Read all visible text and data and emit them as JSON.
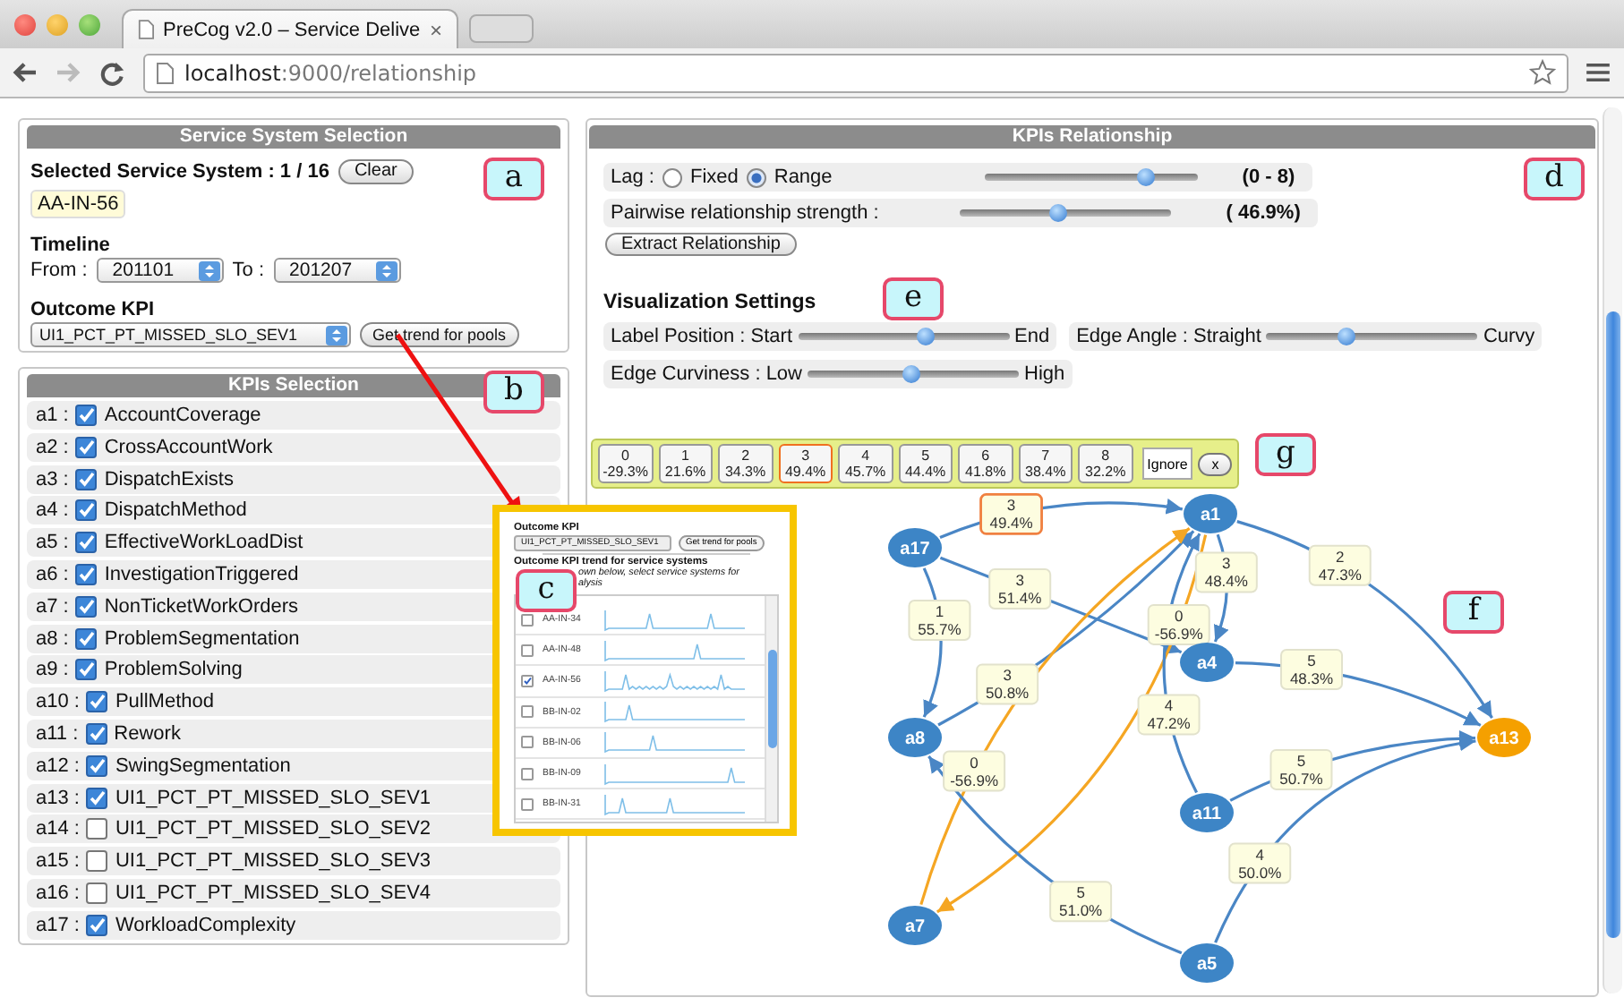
{
  "browser": {
    "tab_title": "PreCog v2.0 – Service Delive",
    "tab_close": "×",
    "url_host": "localhost",
    "url_path": ":9000/relationship"
  },
  "service_selection": {
    "title": "Service System Selection",
    "selected_label": "Selected Service System : 1 / 16",
    "clear_button": "Clear",
    "selected_tags": [
      "AA-IN-56"
    ],
    "timeline_label": "Timeline",
    "from_label": "From :",
    "from_value": "201101",
    "to_label": "To :",
    "to_value": "201207",
    "outcome_label": "Outcome KPI",
    "outcome_value": "UI1_PCT_PT_MISSED_SLO_SEV1",
    "trend_button": "Get trend for pools"
  },
  "kpi_selection": {
    "title": "KPIs Selection",
    "items": [
      {
        "id": "a1 :",
        "name": "AccountCoverage",
        "checked": true
      },
      {
        "id": "a2 :",
        "name": "CrossAccountWork",
        "checked": true
      },
      {
        "id": "a3 :",
        "name": "DispatchExists",
        "checked": true
      },
      {
        "id": "a4 :",
        "name": "DispatchMethod",
        "checked": true
      },
      {
        "id": "a5 :",
        "name": "EffectiveWorkLoadDist",
        "checked": true
      },
      {
        "id": "a6 :",
        "name": "InvestigationTriggered",
        "checked": true
      },
      {
        "id": "a7 :",
        "name": "NonTicketWorkOrders",
        "checked": true
      },
      {
        "id": "a8 :",
        "name": "ProblemSegmentation",
        "checked": true
      },
      {
        "id": "a9 :",
        "name": "ProblemSolving",
        "checked": true
      },
      {
        "id": "a10 :",
        "name": "PullMethod",
        "checked": true
      },
      {
        "id": "a11 :",
        "name": "Rework",
        "checked": true
      },
      {
        "id": "a12 :",
        "name": "SwingSegmentation",
        "checked": true
      },
      {
        "id": "a13 :",
        "name": "UI1_PCT_PT_MISSED_SLO_SEV1",
        "checked": true
      },
      {
        "id": "a14 :",
        "name": "UI1_PCT_PT_MISSED_SLO_SEV2",
        "checked": false
      },
      {
        "id": "a15 :",
        "name": "UI1_PCT_PT_MISSED_SLO_SEV3",
        "checked": false
      },
      {
        "id": "a16 :",
        "name": "UI1_PCT_PT_MISSED_SLO_SEV4",
        "checked": false
      },
      {
        "id": "a17 :",
        "name": "WorkloadComplexity",
        "checked": true
      }
    ]
  },
  "relationship": {
    "title": "KPIs Relationship",
    "lag_label": "Lag :",
    "lag_modes": [
      {
        "label": "Fixed",
        "selected": false
      },
      {
        "label": "Range",
        "selected": true
      }
    ],
    "lag_slider": {
      "level": 0.76
    },
    "lag_reading": "(0 - 8)",
    "strength_label": "Pairwise relationship strength :",
    "strength_slider": {
      "level": 0.47
    },
    "strength_reading": "( 46.9%)",
    "extract_button": "Extract Relationship",
    "settings_title": "Visualization Settings",
    "settings": [
      {
        "label": "Label Position : Start",
        "end": "End",
        "level": 0.61
      },
      {
        "label": "Edge Angle : Straight",
        "end": "Curvy",
        "level": 0.38
      },
      {
        "label": "Edge Curviness : Low",
        "end": "High",
        "level": 0.49
      }
    ],
    "lag_filter": {
      "items": [
        {
          "lag": "0",
          "value": "-29.3%",
          "selected": false
        },
        {
          "lag": "1",
          "value": "21.6%",
          "selected": false
        },
        {
          "lag": "2",
          "value": "34.3%",
          "selected": false
        },
        {
          "lag": "3",
          "value": "49.4%",
          "selected": true
        },
        {
          "lag": "4",
          "value": "45.7%",
          "selected": false
        },
        {
          "lag": "5",
          "value": "44.4%",
          "selected": false
        },
        {
          "lag": "6",
          "value": "41.8%",
          "selected": false
        },
        {
          "lag": "7",
          "value": "38.4%",
          "selected": false
        },
        {
          "lag": "8",
          "value": "32.2%",
          "selected": false
        }
      ],
      "ignore_button": "Ignore",
      "close_button": "x"
    },
    "graph": {
      "nodes": [
        {
          "label": "a1",
          "color": "#3d85c6"
        },
        {
          "label": "a17",
          "color": "#3d85c6"
        },
        {
          "label": "a4",
          "color": "#3d85c6"
        },
        {
          "label": "a8",
          "color": "#3d85c6"
        },
        {
          "label": "a13",
          "color": "#f5a000"
        },
        {
          "label": "a11",
          "color": "#3d85c6"
        },
        {
          "label": "a7",
          "color": "#3d85c6"
        },
        {
          "label": "a5",
          "color": "#3d85c6"
        }
      ],
      "edges": [
        {
          "lag": "3",
          "strength": "49.4%",
          "color": "#4a86c5",
          "selected": true
        },
        {
          "lag": "3",
          "strength": "51.4%",
          "color": "#4a86c5",
          "selected": false
        },
        {
          "lag": "1",
          "strength": "55.7%",
          "color": "#4a86c5",
          "selected": false
        },
        {
          "lag": "3",
          "strength": "50.8%",
          "color": "#4a86c5",
          "selected": false
        },
        {
          "lag": "0",
          "strength": "-56.9%",
          "color": "#f5a623",
          "selected": false
        },
        {
          "lag": "0",
          "strength": "-56.9%",
          "color": "#f5a623",
          "selected": false
        },
        {
          "lag": "5",
          "strength": "51.0%",
          "color": "#4a86c5",
          "selected": false
        },
        {
          "lag": "3",
          "strength": "48.4%",
          "color": "#4a86c5",
          "selected": false
        },
        {
          "lag": "2",
          "strength": "47.3%",
          "color": "#4a86c5",
          "selected": false
        },
        {
          "lag": "5",
          "strength": "48.3%",
          "color": "#4a86c5",
          "selected": false
        },
        {
          "lag": "4",
          "strength": "47.2%",
          "color": "#4a86c5",
          "selected": false
        },
        {
          "lag": "5",
          "strength": "50.7%",
          "color": "#4a86c5",
          "selected": false
        },
        {
          "lag": "4",
          "strength": "50.0%",
          "color": "#4a86c5",
          "selected": false
        }
      ]
    }
  },
  "inset": {
    "outcome_label": "Outcome KPI",
    "outcome_value": "UI1_PCT_PT_MISSED_SLO_SEV1",
    "trend_button": "Get trend for pools",
    "trend_title": "Outcome KPI trend for service systems",
    "hint_lines": [
      "own below, select service systems for",
      "alysis"
    ],
    "rows": [
      {
        "name": "AA-IN-34",
        "checked": false
      },
      {
        "name": "AA-IN-48",
        "checked": false
      },
      {
        "name": "AA-IN-56",
        "checked": true
      },
      {
        "name": "BB-IN-02",
        "checked": false
      },
      {
        "name": "BB-IN-06",
        "checked": false
      },
      {
        "name": "BB-IN-09",
        "checked": false
      },
      {
        "name": "BB-IN-31",
        "checked": false
      }
    ]
  },
  "callouts": [
    "a",
    "b",
    "c",
    "d",
    "e",
    "f",
    "g"
  ]
}
